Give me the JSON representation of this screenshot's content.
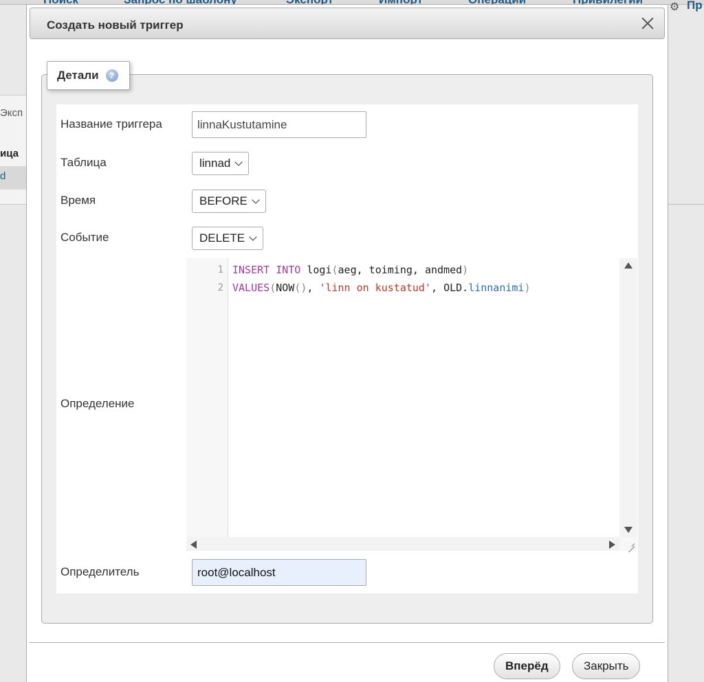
{
  "background": {
    "tabs": [
      "Поиск",
      "Запрос по шаблону",
      "Экспорт",
      "Импорт",
      "Операции",
      "Привилегии"
    ],
    "right_tab": "Пр",
    "left_label": "Эксп",
    "left_header": "ица",
    "left_link": "d"
  },
  "dialog": {
    "title": "Создать новый триггер",
    "legend": "Детали"
  },
  "form": {
    "trigger_name_label": "Название триггера",
    "trigger_name_value": "linnaKustutamine",
    "table_label": "Таблица",
    "table_value": "linnad",
    "time_label": "Время",
    "time_value": "BEFORE",
    "event_label": "Событие",
    "event_value": "DELETE",
    "definition_label": "Определение",
    "definer_label": "Определитель",
    "definer_value": "root@localhost"
  },
  "editor": {
    "line_numbers": [
      "1",
      "2"
    ],
    "line1": {
      "kw1": "INSERT",
      "kw2": "INTO",
      "table": "logi",
      "open": "(",
      "cols": "aeg, toiming, andmed",
      "close": ")"
    },
    "line2": {
      "kw": "VALUES",
      "open": "(",
      "fn": "NOW",
      "fn_parens": "()",
      "sep1": ",",
      "str": "'linn on kustatud'",
      "sep2": ",",
      "obj": "OLD",
      "dot": ".",
      "prop": "linnanimi",
      "close": ")"
    }
  },
  "buttons": {
    "go": "Вперёд",
    "close": "Закрыть"
  },
  "colors": {
    "keyword": "#a33aa3",
    "string": "#c0392b",
    "property": "#2c6db5",
    "definer_bg": "#e8f0fe"
  }
}
